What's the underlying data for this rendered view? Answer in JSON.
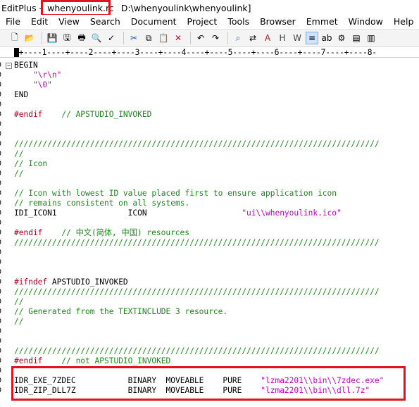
{
  "window": {
    "app_title": "EditPlus -",
    "file_name": "whenyoulink.rc",
    "file_path": "D:\\whenyoulink\\whenyoulink]"
  },
  "menu": [
    "File",
    "Edit",
    "View",
    "Search",
    "Document",
    "Project",
    "Tools",
    "Browser",
    "Emmet",
    "Window",
    "Help"
  ],
  "toolbar": {
    "buttons": [
      "new-file-icon",
      "open-icon",
      "save-icon",
      "save-all-icon",
      "print-icon",
      "print-preview-icon",
      "spellcheck-icon",
      "cut-icon",
      "copy-icon",
      "paste-icon",
      "delete-icon",
      "undo-icon",
      "redo-icon",
      "find-icon",
      "replace-icon",
      "font-icon",
      "hex-icon",
      "word-wrap-icon",
      "column-icon",
      "spellcheck-mode-icon",
      "settings-icon",
      "window-list-icon",
      "toggle-icon"
    ]
  },
  "ruler": "-+----1----+----2----+----3----+----4----+----5----+----6----+----7----+----8-",
  "editor": {
    "lines": [
      {
        "num": "0",
        "fold": "⊟",
        "segments": [
          {
            "t": "BEGIN",
            "c": "c-black"
          }
        ]
      },
      {
        "num": "0",
        "segments": [
          {
            "t": "    \"\\r\\n\"",
            "c": "c-magenta"
          }
        ]
      },
      {
        "num": "0",
        "segments": [
          {
            "t": "    \"\\0\"",
            "c": "c-magenta"
          }
        ]
      },
      {
        "num": "0",
        "segments": [
          {
            "t": "END",
            "c": "c-black"
          }
        ]
      },
      {
        "num": "0",
        "segments": []
      },
      {
        "num": "0",
        "segments": [
          {
            "t": "#endif",
            "c": "c-pp"
          },
          {
            "t": "    // APSTUDIO_INVOKED",
            "c": "c-green"
          }
        ]
      },
      {
        "num": "0",
        "segments": []
      },
      {
        "num": "0",
        "segments": []
      },
      {
        "num": "0",
        "segments": [
          {
            "t": "/////////////////////////////////////////////////////////////////////////////",
            "c": "c-green"
          }
        ]
      },
      {
        "num": "0",
        "segments": [
          {
            "t": "//",
            "c": "c-green"
          }
        ]
      },
      {
        "num": "0",
        "segments": [
          {
            "t": "// Icon",
            "c": "c-green"
          }
        ]
      },
      {
        "num": "0",
        "segments": [
          {
            "t": "//",
            "c": "c-green"
          }
        ]
      },
      {
        "num": "0",
        "segments": []
      },
      {
        "num": "0",
        "segments": [
          {
            "t": "// Icon with lowest ID value placed first to ensure application icon",
            "c": "c-green"
          }
        ]
      },
      {
        "num": "0",
        "segments": [
          {
            "t": "// remains consistent on all systems.",
            "c": "c-green"
          }
        ]
      },
      {
        "num": "0",
        "segments": [
          {
            "t": "IDI_ICON1               ICON                    ",
            "c": "c-black"
          },
          {
            "t": "\"ui\\\\whenyoulink.ico\"",
            "c": "c-magenta"
          }
        ]
      },
      {
        "num": "0",
        "segments": []
      },
      {
        "num": "0",
        "segments": [
          {
            "t": "#endif",
            "c": "c-pp"
          },
          {
            "t": "    // 中文(简体, 中国) resources",
            "c": "c-green"
          }
        ]
      },
      {
        "num": "0",
        "segments": [
          {
            "t": "/////////////////////////////////////////////////////////////////////////////",
            "c": "c-green"
          }
        ]
      },
      {
        "num": "0",
        "segments": []
      },
      {
        "num": "0",
        "segments": []
      },
      {
        "num": "0",
        "segments": []
      },
      {
        "num": "0",
        "segments": [
          {
            "t": "#ifndef",
            "c": "c-pp"
          },
          {
            "t": " APSTUDIO_INVOKED",
            "c": "c-black"
          }
        ]
      },
      {
        "num": "0",
        "segments": [
          {
            "t": "/////////////////////////////////////////////////////////////////////////////",
            "c": "c-green"
          }
        ]
      },
      {
        "num": "0",
        "segments": [
          {
            "t": "//",
            "c": "c-green"
          }
        ]
      },
      {
        "num": "0",
        "segments": [
          {
            "t": "// Generated from the TEXTINCLUDE 3 resource.",
            "c": "c-green"
          }
        ]
      },
      {
        "num": "0",
        "segments": [
          {
            "t": "//",
            "c": "c-green"
          }
        ]
      },
      {
        "num": "0",
        "segments": []
      },
      {
        "num": "0",
        "segments": []
      },
      {
        "num": "0",
        "segments": [
          {
            "t": "/////////////////////////////////////////////////////////////////////////////",
            "c": "c-green"
          }
        ]
      },
      {
        "num": "0",
        "segments": [
          {
            "t": "#endif",
            "c": "c-pp"
          },
          {
            "t": "    // not APSTUDIO_INVOKED",
            "c": "c-green"
          }
        ]
      },
      {
        "num": "0",
        "segments": []
      },
      {
        "num": "0",
        "segments": [
          {
            "t": "IDR_EXE_7ZDEC           BINARY  MOVEABLE    PURE    ",
            "c": "c-black"
          },
          {
            "t": "\"lzma2201\\\\bin\\\\7zdec.exe\"",
            "c": "c-magenta"
          }
        ]
      },
      {
        "num": "0",
        "segments": [
          {
            "t": "IDR_ZIP_DLL7Z           BINARY  MOVEABLE    PURE    ",
            "c": "c-black"
          },
          {
            "t": "\"lzma2201\\\\bin\\\\dll.7z\"",
            "c": "c-magenta"
          }
        ]
      }
    ]
  },
  "highlight_color": "#e0141e"
}
